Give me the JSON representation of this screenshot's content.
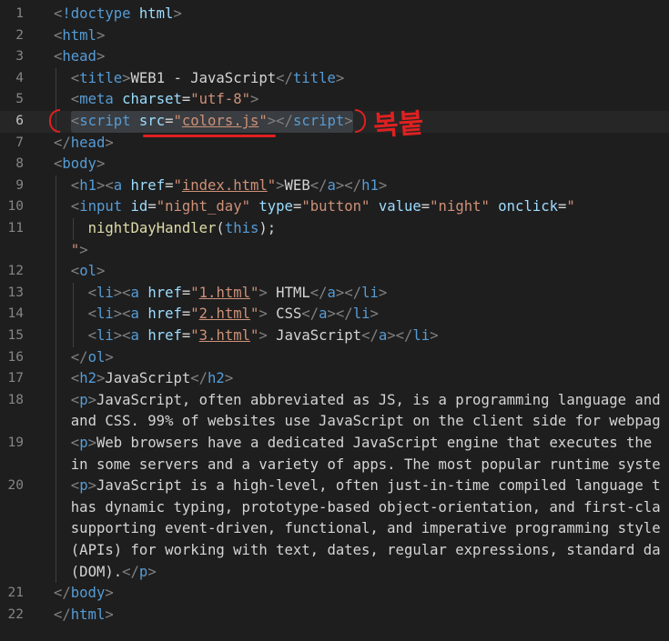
{
  "lines": [
    {
      "n": "1",
      "tokens": [
        [
          "p",
          "<"
        ],
        [
          "t",
          "!doctype"
        ],
        [
          "x",
          " "
        ],
        [
          "a",
          "html"
        ],
        [
          "p",
          ">"
        ]
      ]
    },
    {
      "n": "2",
      "tokens": [
        [
          "p",
          "<"
        ],
        [
          "t",
          "html"
        ],
        [
          "p",
          ">"
        ]
      ]
    },
    {
      "n": "3",
      "tokens": [
        [
          "p",
          "<"
        ],
        [
          "t",
          "head"
        ],
        [
          "p",
          ">"
        ]
      ]
    },
    {
      "n": "4",
      "indent": 1,
      "tokens": [
        [
          "p",
          "<"
        ],
        [
          "t",
          "title"
        ],
        [
          "p",
          ">"
        ],
        [
          "x",
          "WEB1 - JavaScript"
        ],
        [
          "p",
          "</"
        ],
        [
          "t",
          "title"
        ],
        [
          "p",
          ">"
        ]
      ]
    },
    {
      "n": "5",
      "indent": 1,
      "tokens": [
        [
          "p",
          "<"
        ],
        [
          "t",
          "meta"
        ],
        [
          "x",
          " "
        ],
        [
          "a",
          "charset"
        ],
        [
          "x",
          "="
        ],
        [
          "s",
          "\"utf-8\""
        ],
        [
          "p",
          ">"
        ]
      ]
    },
    {
      "n": "6",
      "indent": 1,
      "active": true,
      "tokens": [
        [
          "p",
          "<"
        ],
        [
          "t",
          "script"
        ],
        [
          "x",
          " "
        ],
        [
          "a",
          "src"
        ],
        [
          "x",
          "="
        ],
        [
          "s",
          "\""
        ],
        [
          "su",
          "colors.js"
        ],
        [
          "s",
          "\""
        ],
        [
          "p",
          ">"
        ],
        [
          "p",
          "</"
        ],
        [
          "t",
          "script"
        ],
        [
          "p",
          ">"
        ]
      ]
    },
    {
      "n": "7",
      "tokens": [
        [
          "p",
          "</"
        ],
        [
          "t",
          "head"
        ],
        [
          "p",
          ">"
        ]
      ]
    },
    {
      "n": "8",
      "tokens": [
        [
          "p",
          "<"
        ],
        [
          "t",
          "body"
        ],
        [
          "p",
          ">"
        ]
      ]
    },
    {
      "n": "9",
      "indent": 1,
      "tokens": [
        [
          "p",
          "<"
        ],
        [
          "t",
          "h1"
        ],
        [
          "p",
          ">"
        ],
        [
          "p",
          "<"
        ],
        [
          "t",
          "a"
        ],
        [
          "x",
          " "
        ],
        [
          "a",
          "href"
        ],
        [
          "x",
          "="
        ],
        [
          "s",
          "\""
        ],
        [
          "su",
          "index.html"
        ],
        [
          "s",
          "\""
        ],
        [
          "p",
          ">"
        ],
        [
          "x",
          "WEB"
        ],
        [
          "p",
          "</"
        ],
        [
          "t",
          "a"
        ],
        [
          "p",
          ">"
        ],
        [
          "p",
          "</"
        ],
        [
          "t",
          "h1"
        ],
        [
          "p",
          ">"
        ]
      ]
    },
    {
      "n": "10",
      "indent": 1,
      "tokens": [
        [
          "p",
          "<"
        ],
        [
          "t",
          "input"
        ],
        [
          "x",
          " "
        ],
        [
          "a",
          "id"
        ],
        [
          "x",
          "="
        ],
        [
          "s",
          "\"night_day\""
        ],
        [
          "x",
          " "
        ],
        [
          "a",
          "type"
        ],
        [
          "x",
          "="
        ],
        [
          "s",
          "\"button\""
        ],
        [
          "x",
          " "
        ],
        [
          "a",
          "value"
        ],
        [
          "x",
          "="
        ],
        [
          "s",
          "\"night\""
        ],
        [
          "x",
          " "
        ],
        [
          "a",
          "onclick"
        ],
        [
          "x",
          "="
        ],
        [
          "s",
          "\""
        ]
      ]
    },
    {
      "n": "11",
      "indent": 2,
      "tokens": [
        [
          "f",
          "nightDayHandler"
        ],
        [
          "x",
          "("
        ],
        [
          "k",
          "this"
        ],
        [
          "x",
          ");"
        ]
      ]
    },
    {
      "n": "",
      "indent": 1,
      "tokens": [
        [
          "s",
          "\""
        ],
        [
          "p",
          ">"
        ]
      ]
    },
    {
      "n": "12",
      "indent": 1,
      "tokens": [
        [
          "p",
          "<"
        ],
        [
          "t",
          "ol"
        ],
        [
          "p",
          ">"
        ]
      ]
    },
    {
      "n": "13",
      "indent": 2,
      "tokens": [
        [
          "p",
          "<"
        ],
        [
          "t",
          "li"
        ],
        [
          "p",
          ">"
        ],
        [
          "p",
          "<"
        ],
        [
          "t",
          "a"
        ],
        [
          "x",
          " "
        ],
        [
          "a",
          "href"
        ],
        [
          "x",
          "="
        ],
        [
          "s",
          "\""
        ],
        [
          "su",
          "1.html"
        ],
        [
          "s",
          "\""
        ],
        [
          "p",
          ">"
        ],
        [
          "x",
          " HTML"
        ],
        [
          "p",
          "</"
        ],
        [
          "t",
          "a"
        ],
        [
          "p",
          ">"
        ],
        [
          "p",
          "</"
        ],
        [
          "t",
          "li"
        ],
        [
          "p",
          ">"
        ]
      ]
    },
    {
      "n": "14",
      "indent": 2,
      "tokens": [
        [
          "p",
          "<"
        ],
        [
          "t",
          "li"
        ],
        [
          "p",
          ">"
        ],
        [
          "p",
          "<"
        ],
        [
          "t",
          "a"
        ],
        [
          "x",
          " "
        ],
        [
          "a",
          "href"
        ],
        [
          "x",
          "="
        ],
        [
          "s",
          "\""
        ],
        [
          "su",
          "2.html"
        ],
        [
          "s",
          "\""
        ],
        [
          "p",
          ">"
        ],
        [
          "x",
          " CSS"
        ],
        [
          "p",
          "</"
        ],
        [
          "t",
          "a"
        ],
        [
          "p",
          ">"
        ],
        [
          "p",
          "</"
        ],
        [
          "t",
          "li"
        ],
        [
          "p",
          ">"
        ]
      ]
    },
    {
      "n": "15",
      "indent": 2,
      "tokens": [
        [
          "p",
          "<"
        ],
        [
          "t",
          "li"
        ],
        [
          "p",
          ">"
        ],
        [
          "p",
          "<"
        ],
        [
          "t",
          "a"
        ],
        [
          "x",
          " "
        ],
        [
          "a",
          "href"
        ],
        [
          "x",
          "="
        ],
        [
          "s",
          "\""
        ],
        [
          "su",
          "3.html"
        ],
        [
          "s",
          "\""
        ],
        [
          "p",
          ">"
        ],
        [
          "x",
          " JavaScript"
        ],
        [
          "p",
          "</"
        ],
        [
          "t",
          "a"
        ],
        [
          "p",
          ">"
        ],
        [
          "p",
          "</"
        ],
        [
          "t",
          "li"
        ],
        [
          "p",
          ">"
        ]
      ]
    },
    {
      "n": "16",
      "indent": 1,
      "tokens": [
        [
          "p",
          "</"
        ],
        [
          "t",
          "ol"
        ],
        [
          "p",
          ">"
        ]
      ]
    },
    {
      "n": "17",
      "indent": 1,
      "tokens": [
        [
          "p",
          "<"
        ],
        [
          "t",
          "h2"
        ],
        [
          "p",
          ">"
        ],
        [
          "x",
          "JavaScript"
        ],
        [
          "p",
          "</"
        ],
        [
          "t",
          "h2"
        ],
        [
          "p",
          ">"
        ]
      ]
    },
    {
      "n": "18",
      "indent": 1,
      "tokens": [
        [
          "p",
          "<"
        ],
        [
          "t",
          "p"
        ],
        [
          "p",
          ">"
        ],
        [
          "x",
          "JavaScript, often abbreviated as JS, is a programming language and"
        ]
      ]
    },
    {
      "n": "",
      "indent": 1,
      "tokens": [
        [
          "x",
          "and CSS. 99% of websites use JavaScript on the client side for webpag"
        ]
      ]
    },
    {
      "n": "19",
      "indent": 1,
      "tokens": [
        [
          "p",
          "<"
        ],
        [
          "t",
          "p"
        ],
        [
          "p",
          ">"
        ],
        [
          "x",
          "Web browsers have a dedicated JavaScript engine that executes the"
        ]
      ]
    },
    {
      "n": "",
      "indent": 1,
      "tokens": [
        [
          "x",
          "in some servers and a variety of apps. The most popular runtime syste"
        ]
      ]
    },
    {
      "n": "20",
      "indent": 1,
      "tokens": [
        [
          "p",
          "<"
        ],
        [
          "t",
          "p"
        ],
        [
          "p",
          ">"
        ],
        [
          "x",
          "JavaScript is a high-level, often just-in-time compiled language t"
        ]
      ]
    },
    {
      "n": "",
      "indent": 1,
      "tokens": [
        [
          "x",
          "has dynamic typing, prototype-based object-orientation, and first-cla"
        ]
      ]
    },
    {
      "n": "",
      "indent": 1,
      "tokens": [
        [
          "x",
          "supporting event-driven, functional, and imperative programming style"
        ]
      ]
    },
    {
      "n": "",
      "indent": 1,
      "tokens": [
        [
          "x",
          "(APIs) for working with text, dates, regular expressions, standard da"
        ]
      ]
    },
    {
      "n": "",
      "indent": 1,
      "tokens": [
        [
          "x",
          "(DOM)."
        ],
        [
          "p",
          "</"
        ],
        [
          "t",
          "p"
        ],
        [
          "p",
          ">"
        ]
      ]
    },
    {
      "n": "21",
      "tokens": [
        [
          "p",
          "</"
        ],
        [
          "t",
          "body"
        ],
        [
          "p",
          ">"
        ]
      ]
    },
    {
      "n": "22",
      "tokens": [
        [
          "p",
          "</"
        ],
        [
          "t",
          "html"
        ],
        [
          "p",
          ">"
        ]
      ]
    }
  ],
  "annotation": {
    "note": "복붙"
  }
}
